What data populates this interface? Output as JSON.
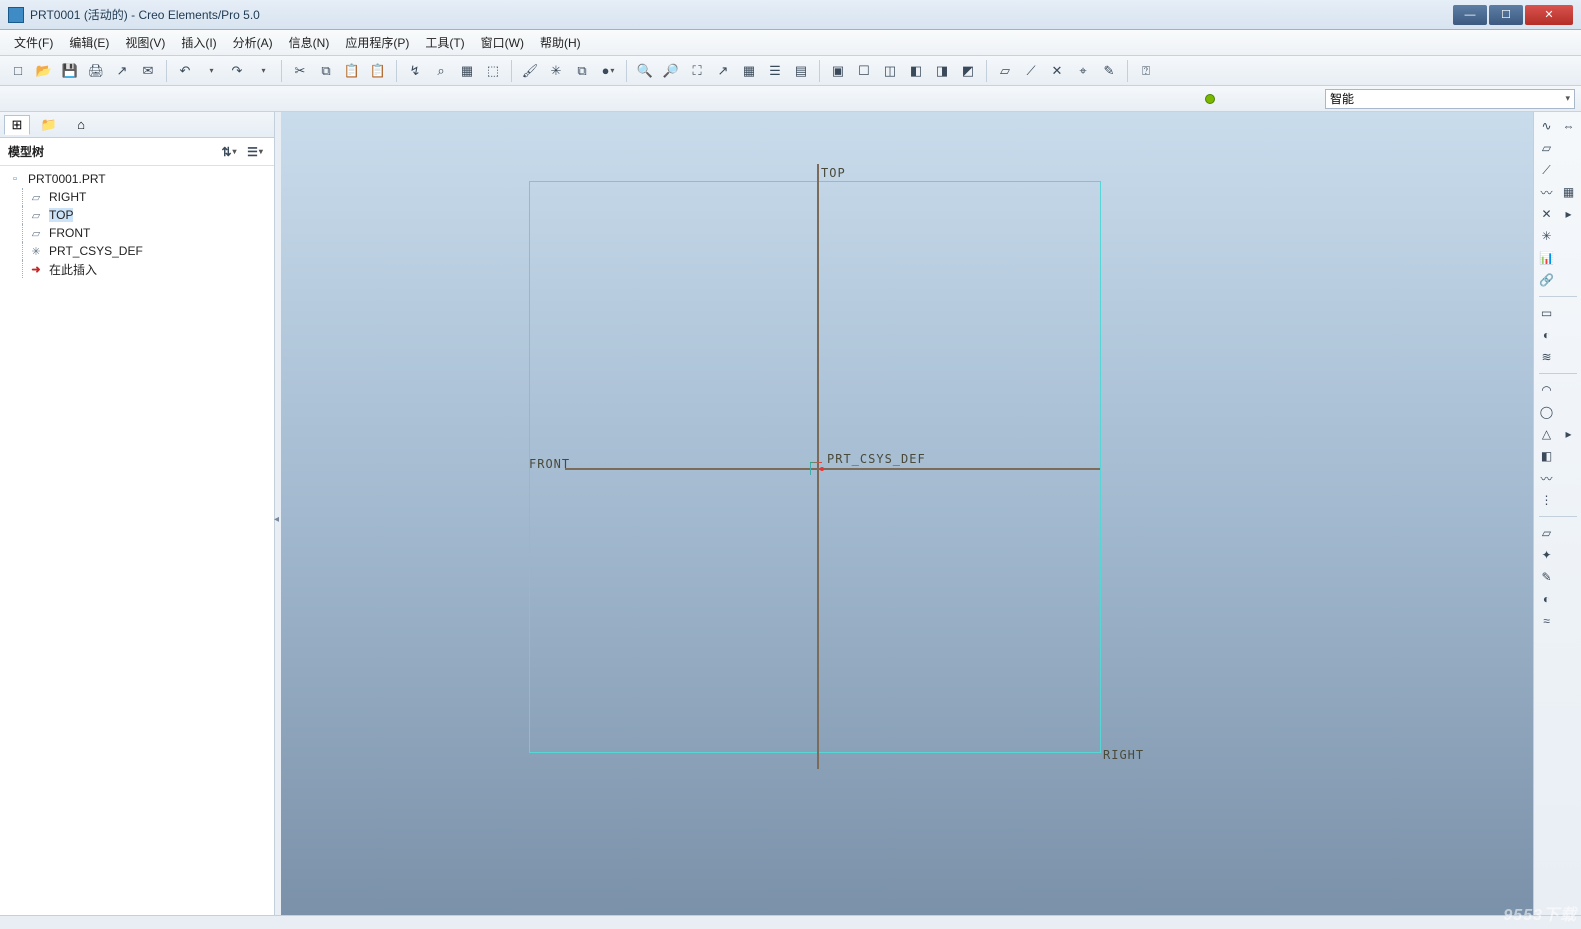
{
  "window": {
    "title": "PRT0001 (活动的) - Creo Elements/Pro 5.0"
  },
  "menu": {
    "items": [
      "文件(F)",
      "编辑(E)",
      "视图(V)",
      "插入(I)",
      "分析(A)",
      "信息(N)",
      "应用程序(P)",
      "工具(T)",
      "窗口(W)",
      "帮助(H)"
    ]
  },
  "toolbar_main_names": [
    "new-file",
    "open-file",
    "save-file",
    "print",
    "export",
    "mail",
    "sep",
    "undo",
    "undo-drop",
    "redo",
    "redo-drop",
    "sep",
    "cut",
    "copy",
    "paste",
    "paste-special",
    "sep",
    "regenerate",
    "find",
    "model-player",
    "select-box",
    "sep",
    "repaint",
    "spin-center",
    "named-views",
    "shade-drop",
    "sep",
    "zoom-in",
    "zoom-out",
    "zoom-fit",
    "reorient",
    "saved-views",
    "layers",
    "view-manager",
    "sep",
    "window-activate",
    "close-window",
    "new-window",
    "tile",
    "cascade",
    "model-display",
    "sep",
    "datum-plane",
    "datum-axis",
    "datum-point",
    "datum-csys",
    "annotation",
    "sep",
    "help-pointer"
  ],
  "toolbar_main_glyphs": [
    "□",
    "📂",
    "💾",
    "🖨",
    "↗",
    "✉",
    "|",
    "↶",
    "",
    "↷",
    "",
    "|",
    "✂",
    "⧉",
    "📋",
    "📋",
    "|",
    "↯",
    "⌕",
    "▦",
    "⬚",
    "|",
    "🖌",
    "✳",
    "⧉",
    "●",
    "|",
    "🔍",
    "🔎",
    "⛶",
    "↗",
    "▦",
    "☰",
    "▤",
    "|",
    "▣",
    "☐",
    "◫",
    "◧",
    "◨",
    "◩",
    "|",
    "▱",
    "⟋",
    "✕",
    "⌖",
    "✎",
    "|",
    "⍰"
  ],
  "selector": {
    "smart": "智能"
  },
  "left": {
    "tabs_names": [
      "model-tree-tab",
      "folder-browser-tab",
      "favorites-tab"
    ],
    "tabs_glyphs": [
      "⊞",
      "📁",
      "⌂"
    ],
    "header": "模型树",
    "hdr_btns": [
      "filter-icon",
      "settings-icon"
    ],
    "hdr_glyphs": [
      "⇅",
      "☰"
    ]
  },
  "tree": {
    "root": "PRT0001.PRT",
    "items": [
      {
        "icon": "▱",
        "label": "RIGHT",
        "name": "datum-right"
      },
      {
        "icon": "▱",
        "label": "TOP",
        "name": "datum-top",
        "selected": true
      },
      {
        "icon": "▱",
        "label": "FRONT",
        "name": "datum-front"
      },
      {
        "icon": "✳",
        "label": "PRT_CSYS_DEF",
        "name": "datum-csys"
      },
      {
        "icon": "➜",
        "label": "在此插入",
        "name": "insert-here",
        "ins": true
      }
    ]
  },
  "canvas": {
    "labels": {
      "top": "TOP",
      "front": "FRONT",
      "right": "RIGHT",
      "csys": "PRT_CSYS_DEF"
    }
  },
  "rightbar_groups": [
    [
      [
        "sketch-line",
        "∿"
      ],
      [
        "mirror",
        "⇔"
      ]
    ],
    [
      [
        "plane",
        "▱"
      ],
      [
        "",
        ""
      ]
    ],
    [
      [
        "axis",
        "⟋"
      ],
      [
        "",
        ""
      ]
    ],
    [
      [
        "curve",
        "〰"
      ],
      [
        "table",
        "▦"
      ]
    ],
    [
      [
        "point",
        "✕"
      ],
      [
        "point-drop",
        "▸"
      ]
    ],
    [
      [
        "csys",
        "✳"
      ],
      [
        "",
        ""
      ]
    ],
    [
      [
        "analysis",
        "📊"
      ],
      [
        "",
        ""
      ]
    ],
    [
      [
        "tie",
        "🔗"
      ],
      [
        "",
        ""
      ]
    ],
    "sep",
    [
      [
        "extrude",
        "▭"
      ],
      [
        "",
        ""
      ]
    ],
    [
      [
        "revolve",
        "◐"
      ],
      [
        "",
        ""
      ]
    ],
    [
      [
        "sweep",
        "≋"
      ],
      [
        "",
        ""
      ]
    ],
    "sep",
    [
      [
        "round",
        "◠"
      ],
      [
        "",
        ""
      ]
    ],
    [
      [
        "hole",
        "◯"
      ],
      [
        "",
        ""
      ]
    ],
    [
      [
        "draft",
        "△"
      ],
      [
        "draft-drop",
        "▸"
      ]
    ],
    [
      [
        "shell",
        "◧"
      ],
      [
        "",
        ""
      ]
    ],
    [
      [
        "rib",
        "〰"
      ],
      [
        "",
        ""
      ]
    ],
    [
      [
        "pattern",
        "⋮"
      ],
      [
        "",
        ""
      ]
    ],
    "sep",
    [
      [
        "copy-geom",
        "▱"
      ],
      [
        "",
        ""
      ]
    ],
    [
      [
        "publish",
        "✦"
      ],
      [
        "",
        ""
      ]
    ],
    [
      [
        "style",
        "✎"
      ],
      [
        "",
        ""
      ]
    ],
    [
      [
        "render",
        "◐"
      ],
      [
        "",
        ""
      ]
    ],
    [
      [
        "warp",
        "≈"
      ],
      [
        "",
        ""
      ]
    ]
  ],
  "watermark": "9553下载"
}
